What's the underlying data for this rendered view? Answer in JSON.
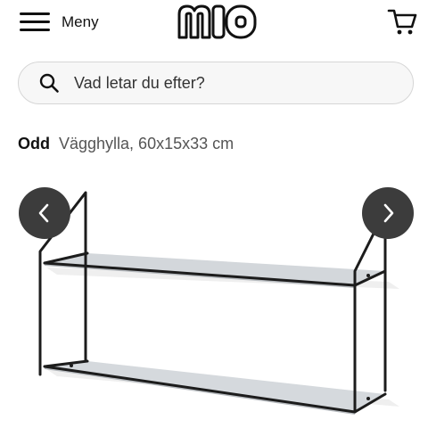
{
  "header": {
    "menu_label": "Meny",
    "logo_text": "mio",
    "logo_icon": "mio-logo",
    "menu_icon": "hamburger-icon",
    "cart_icon": "cart-icon"
  },
  "search": {
    "placeholder": "Vad letar du efter?",
    "icon": "search-icon"
  },
  "product": {
    "brand": "Odd",
    "name": "Vägghylla, 60x15x33 cm",
    "image": "wall-shelf-photo"
  },
  "carousel": {
    "prev_icon": "chevron-left-icon",
    "next_icon": "chevron-right-icon"
  }
}
